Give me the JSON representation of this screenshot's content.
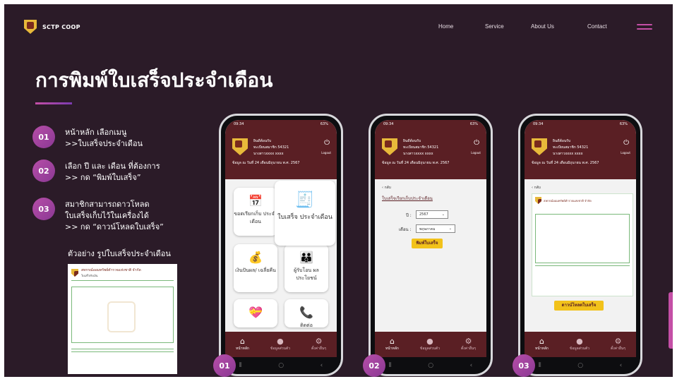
{
  "nav": {
    "brand": "SCTP COOP",
    "links": [
      "Home",
      "Service",
      "About Us",
      "Contact"
    ]
  },
  "hero": {
    "title": "การพิมพ์ใบเสร็จประจำเดือน"
  },
  "steps": [
    {
      "num": "01",
      "lines": [
        "หน้าหลัก เลือกเมนู",
        ">>ใบเสร็จประจำเดือน"
      ]
    },
    {
      "num": "02",
      "lines": [
        "เลือก ปี และ เดือน ที่ต้องการ",
        ">> กด “พิมพ์ใบเสร็จ”"
      ]
    },
    {
      "num": "03",
      "lines": [
        "สมาชิกสามารถดาวโหลด",
        "ใบเสร็จเก็บไว้ในเครื่องได้",
        ">> กด “ดาวน์โหลดใบเสร็จ”"
      ]
    }
  ],
  "sample": {
    "label": "ตัวอย่าง รูปใบเสร็จประจำเดือน",
    "org": "สหกรณ์ออมทรัพย์ตำรวจแห่งชาติ จำกัด",
    "doc": "ใบเสร็จรับเงิน"
  },
  "phone_common": {
    "time": "09:34",
    "battery": "63%",
    "welcome": "ยินดีต้อนรับ",
    "member": "ทะเบียนสมาชิก 54321",
    "name": "นางสาวxxxx xxxx",
    "date": "ข้อมูล ณ วันที่ 24 เดือนมิถุนายน พ.ศ. 2567",
    "logout": "Logout",
    "tabs": [
      "หน้าหลัก",
      "ข้อมูลส่วนตัว",
      "ตั้งค่าอื่นๆ"
    ]
  },
  "phone1": {
    "tiles": [
      "ขอตเรียกเก็บ ประจำเดือน",
      "ใบเสร็จ ประจำเดือน",
      "เงินปันผล/ เฉลี่ยคืน",
      "ผู้รับโอน ผลประโยชน์",
      "",
      "ติดต่อ"
    ],
    "num": "01"
  },
  "phone2": {
    "back": "กลับ",
    "heading": "ใบเสร็จเรียกเก็บประจำเดือน",
    "year_label": "ปี :",
    "year_value": "2567",
    "month_label": "เดือน :",
    "month_value": "พฤษภาคม",
    "print_button": "พิมพ์ใบเสร็จ",
    "num": "02"
  },
  "phone3": {
    "back": "กลับ",
    "download_button": "ดาวน์โหลดใบเสร็จ",
    "num": "03"
  }
}
